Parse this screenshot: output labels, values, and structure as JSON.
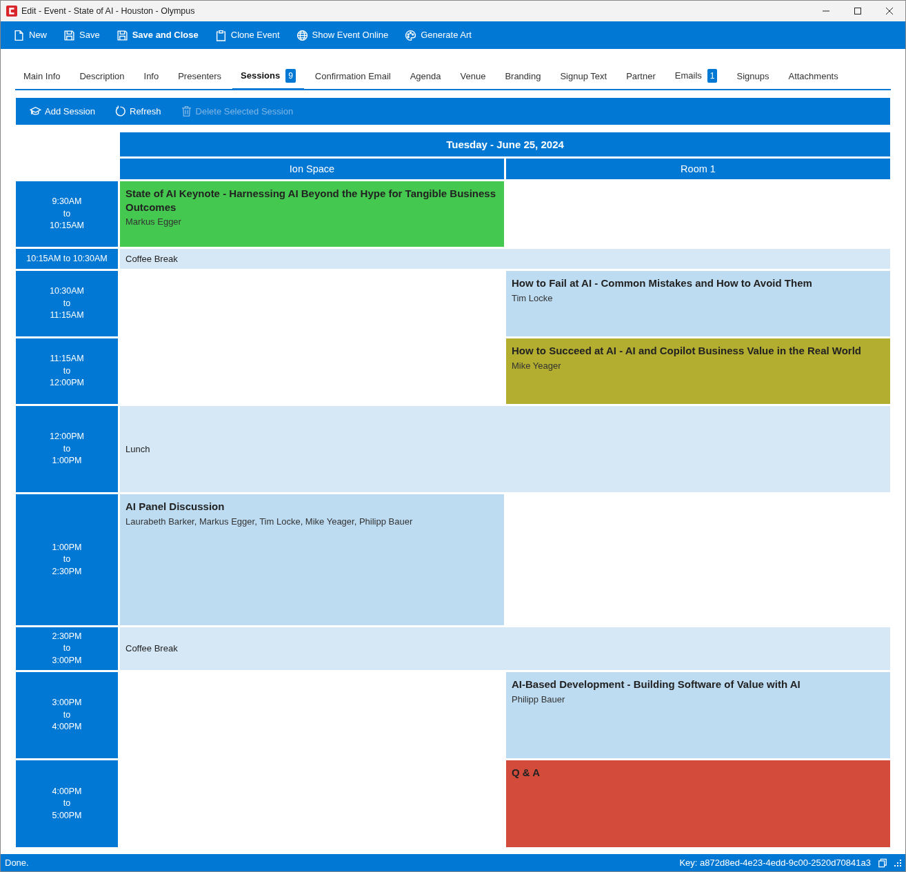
{
  "window": {
    "title": "Edit - Event - State of AI - Houston - Olympus"
  },
  "toolbar": [
    {
      "kind": "document",
      "label": "New",
      "bold": false
    },
    {
      "kind": "disk",
      "label": "Save",
      "bold": false
    },
    {
      "kind": "disk",
      "label": "Save and Close",
      "bold": true
    },
    {
      "kind": "clipboard",
      "label": "Clone Event",
      "bold": false
    },
    {
      "kind": "globe",
      "label": "Show Event Online",
      "bold": false
    },
    {
      "kind": "palette",
      "label": "Generate Art",
      "bold": false
    }
  ],
  "tabs": [
    {
      "label": "Main Info",
      "selected": false
    },
    {
      "label": "Description",
      "selected": false
    },
    {
      "label": "Info",
      "selected": false
    },
    {
      "label": "Presenters",
      "selected": false
    },
    {
      "label": "Sessions",
      "selected": true,
      "badge": "9"
    },
    {
      "label": "Confirmation Email",
      "selected": false
    },
    {
      "label": "Agenda",
      "selected": false
    },
    {
      "label": "Venue",
      "selected": false
    },
    {
      "label": "Branding",
      "selected": false
    },
    {
      "label": "Signup Text",
      "selected": false
    },
    {
      "label": "Partner",
      "selected": false
    },
    {
      "label": "Emails",
      "selected": false,
      "badge": "1"
    },
    {
      "label": "Signups",
      "selected": false
    },
    {
      "label": "Attachments",
      "selected": false
    }
  ],
  "session_toolbar": [
    {
      "kind": "cap",
      "label": "Add Session",
      "disabled": false
    },
    {
      "kind": "refresh",
      "label": "Refresh",
      "disabled": false
    },
    {
      "kind": "trash",
      "label": "Delete Selected Session",
      "disabled": true
    }
  ],
  "schedule": {
    "date": "Tuesday - June 25, 2024",
    "rooms": [
      "Ion Space",
      "Room 1"
    ],
    "slots": [
      {
        "kind": "sessions",
        "time": [
          "9:30AM",
          "to",
          "10:15AM"
        ],
        "cells": [
          {
            "kind": "session",
            "title": "State of AI Keynote - Harnessing AI Beyond the Hype for Tangible Business Outcomes",
            "presenters": "Markus Egger",
            "color": "#45c84f"
          },
          {
            "kind": "empty"
          }
        ]
      },
      {
        "kind": "break",
        "time": [
          "10:15AM to 10:30AM"
        ],
        "label": "Coffee Break"
      },
      {
        "kind": "sessions",
        "time": [
          "10:30AM",
          "to",
          "11:15AM"
        ],
        "cells": [
          {
            "kind": "empty"
          },
          {
            "kind": "session",
            "title": "How to Fail at AI - Common Mistakes and How to Avoid Them",
            "presenters": "Tim Locke",
            "color": "#bddcf2"
          }
        ]
      },
      {
        "kind": "sessions",
        "time": [
          "11:15AM",
          "to",
          "12:00PM"
        ],
        "cells": [
          {
            "kind": "empty"
          },
          {
            "kind": "session",
            "title": "How to Succeed at AI - AI and Copilot Business Value in the Real World",
            "presenters": "Mike Yeager",
            "color": "#b3ae30"
          }
        ]
      },
      {
        "kind": "break",
        "time": [
          "12:00PM",
          "to",
          "1:00PM"
        ],
        "label": "Lunch"
      },
      {
        "kind": "sessions",
        "time": [
          "1:00PM",
          "to",
          "2:30PM"
        ],
        "cells": [
          {
            "kind": "session",
            "title": "AI Panel Discussion",
            "presenters": "Laurabeth Barker, Markus Egger, Tim Locke, Mike Yeager, Philipp Bauer",
            "color": "#bddcf2"
          },
          {
            "kind": "empty"
          }
        ]
      },
      {
        "kind": "break",
        "time": [
          "2:30PM",
          "to",
          "3:00PM"
        ],
        "label": "Coffee Break"
      },
      {
        "kind": "sessions",
        "time": [
          "3:00PM",
          "to",
          "4:00PM"
        ],
        "cells": [
          {
            "kind": "empty"
          },
          {
            "kind": "session",
            "title": "AI-Based Development - Building Software of Value with AI",
            "presenters": "Philipp Bauer",
            "color": "#bddcf2"
          }
        ]
      },
      {
        "kind": "sessions",
        "time": [
          "4:00PM",
          "to",
          "5:00PM"
        ],
        "cells": [
          {
            "kind": "empty"
          },
          {
            "kind": "session",
            "title": "Q & A",
            "color": "#d24b3b"
          }
        ]
      }
    ]
  },
  "status_bar": {
    "message": "Done.",
    "key": "Key: a872d8ed-4e23-4edd-9c00-2520d70841a3"
  }
}
